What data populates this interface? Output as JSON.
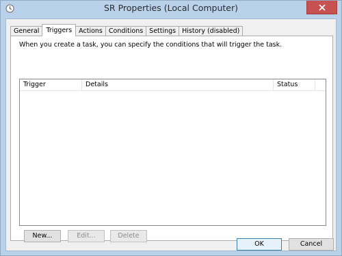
{
  "window": {
    "title": "SR Properties (Local Computer)",
    "icons": {
      "app": "clock-icon",
      "close": "close-icon"
    },
    "colors": {
      "frame": "#b9d1ea",
      "close": "#c75050",
      "client": "#f0f0f0"
    }
  },
  "tabs": [
    {
      "label": "General",
      "active": false
    },
    {
      "label": "Triggers",
      "active": true
    },
    {
      "label": "Actions",
      "active": false
    },
    {
      "label": "Conditions",
      "active": false
    },
    {
      "label": "Settings",
      "active": false
    },
    {
      "label": "History (disabled)",
      "active": false
    }
  ],
  "triggers": {
    "description": "When you create a task, you can specify the conditions that will trigger the task.",
    "columns": [
      "Trigger",
      "Details",
      "Status"
    ],
    "rows": [],
    "buttons": {
      "new": "New...",
      "edit": "Edit...",
      "delete": "Delete"
    }
  },
  "dialog": {
    "ok": "OK",
    "cancel": "Cancel"
  }
}
